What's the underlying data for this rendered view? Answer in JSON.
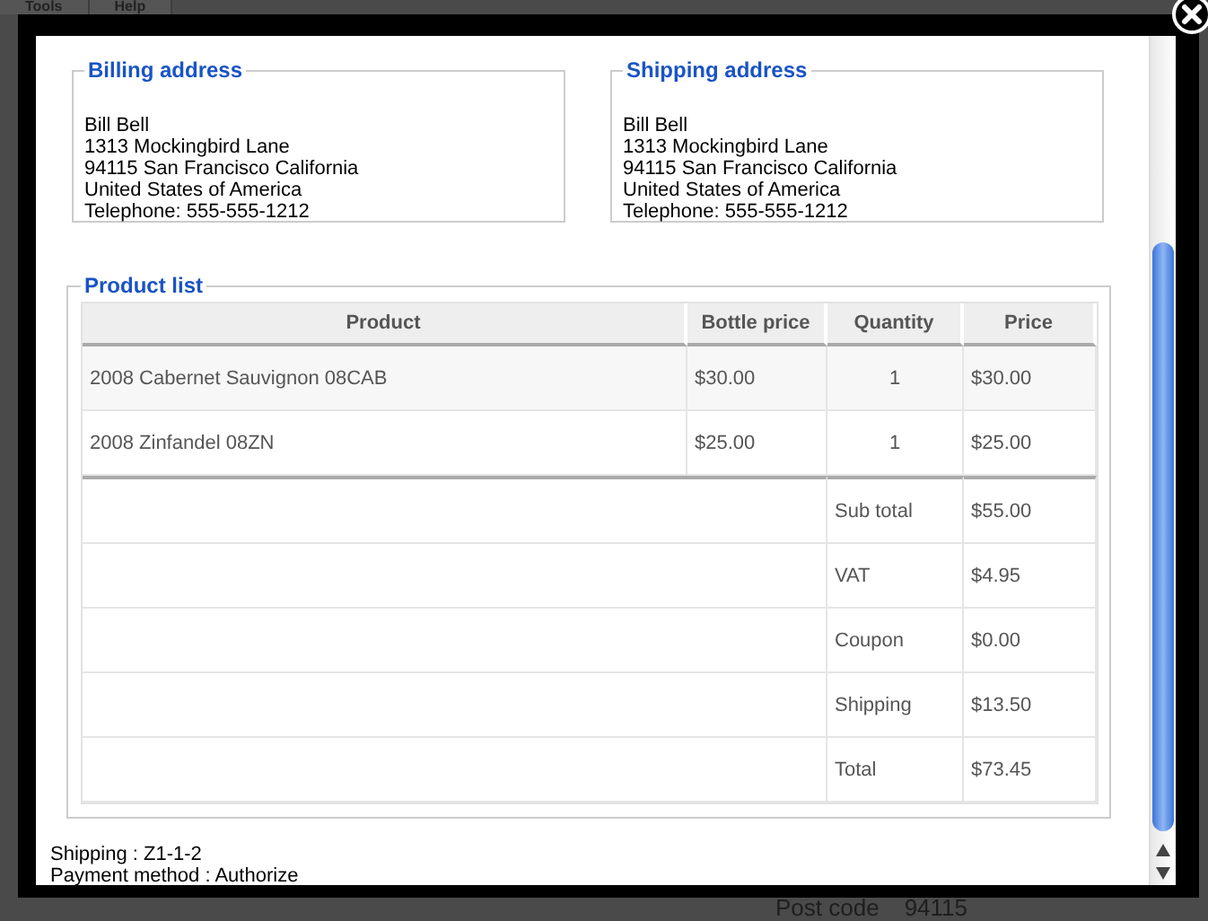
{
  "background": {
    "menu": [
      "Tools",
      "Help"
    ],
    "post_code_label": "Post code",
    "post_code_value": "94115"
  },
  "billing": {
    "title": "Billing address",
    "lines": [
      "Bill Bell",
      "1313 Mockingbird Lane",
      "94115 San Francisco California",
      "United States of America",
      "Telephone: 555-555-1212"
    ]
  },
  "shipping": {
    "title": "Shipping address",
    "lines": [
      "Bill Bell",
      "1313 Mockingbird Lane",
      "94115 San Francisco California",
      "United States of America",
      "Telephone: 555-555-1212"
    ]
  },
  "product_list": {
    "title": "Product list",
    "columns": [
      "Product",
      "Bottle price",
      "Quantity",
      "Price"
    ],
    "rows": [
      [
        "2008 Cabernet Sauvignon 08CAB",
        "$30.00",
        "1",
        "$30.00"
      ],
      [
        "2008 Zinfandel 08ZN",
        "$25.00",
        "1",
        "$25.00"
      ]
    ],
    "summary": [
      {
        "label": "Sub total",
        "value": "$55.00"
      },
      {
        "label": "VAT",
        "value": "$4.95"
      },
      {
        "label": "Coupon",
        "value": "$0.00"
      },
      {
        "label": "Shipping",
        "value": "$13.50"
      },
      {
        "label": "Total",
        "value": "$73.45"
      }
    ]
  },
  "footer_lines": [
    "Shipping : Z1-1-2",
    "Payment method : Authorize"
  ]
}
